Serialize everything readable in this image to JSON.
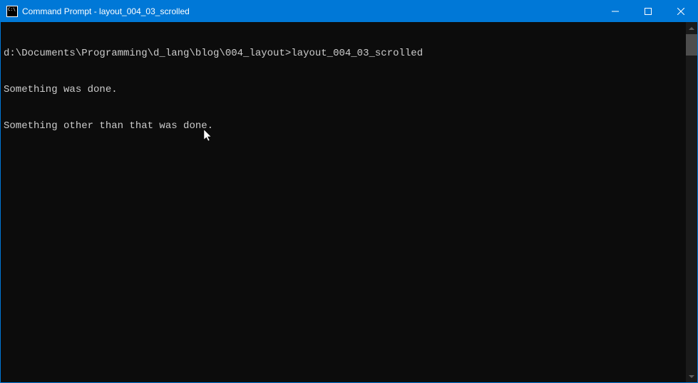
{
  "window": {
    "title": "Command Prompt - layout_004_03_scrolled"
  },
  "terminal": {
    "prompt": "d:\\Documents\\Programming\\d_lang\\blog\\004_layout>",
    "command": "layout_004_03_scrolled",
    "output_lines": [
      "Something was done.",
      "Something other than that was done."
    ]
  },
  "colors": {
    "titlebar_bg": "#0078d7",
    "terminal_bg": "#0c0c0c",
    "terminal_fg": "#cccccc"
  }
}
